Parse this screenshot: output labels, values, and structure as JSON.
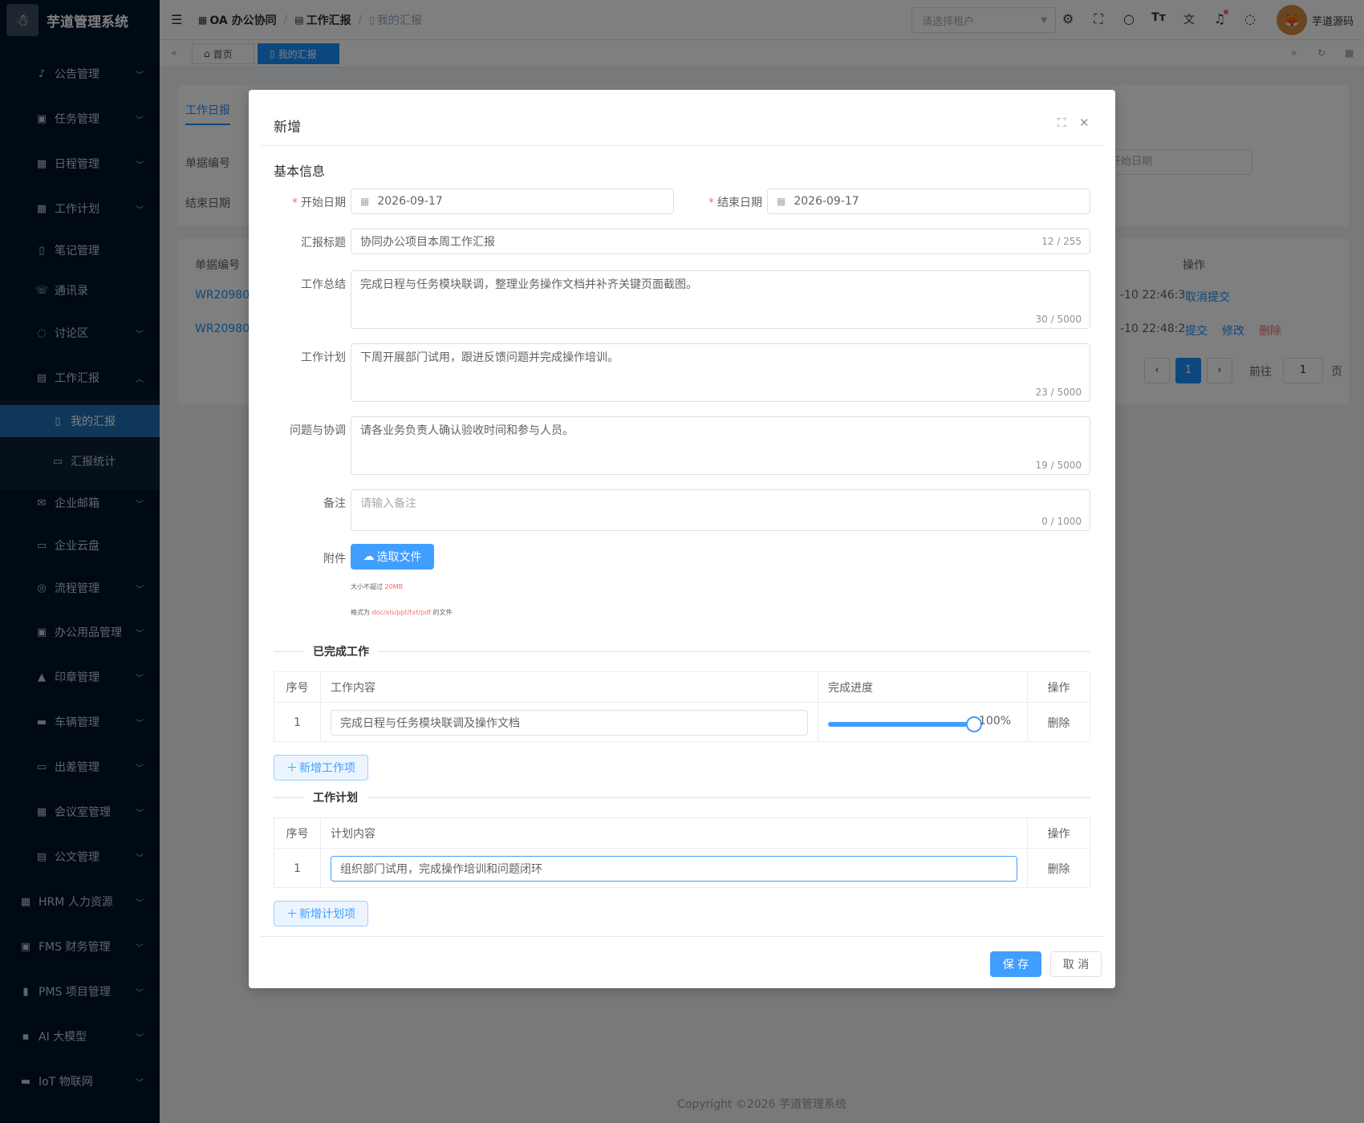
{
  "app": {
    "logo_text": "芋道管理系统"
  },
  "sidebar": {
    "items": [
      {
        "label": "公告管理",
        "icon": "bell-icon"
      },
      {
        "label": "任务管理",
        "icon": "clipboard-icon"
      },
      {
        "label": "日程管理",
        "icon": "calendar-icon"
      },
      {
        "label": "工作计划",
        "icon": "calendar-icon"
      },
      {
        "label": "笔记管理",
        "icon": "notebook-icon"
      },
      {
        "label": "通讯录",
        "icon": "phone-icon"
      },
      {
        "label": "讨论区",
        "icon": "chat-icon"
      },
      {
        "label": "工作汇报",
        "icon": "report-icon"
      },
      {
        "label": "我的汇报",
        "icon": "document-icon"
      },
      {
        "label": "汇报统计",
        "icon": "chart-icon"
      },
      {
        "label": "企业邮箱",
        "icon": "mail-icon"
      },
      {
        "label": "企业云盘",
        "icon": "folder-icon"
      },
      {
        "label": "流程管理",
        "icon": "flow-icon"
      },
      {
        "label": "办公用品管理",
        "icon": "box-icon"
      },
      {
        "label": "印章管理",
        "icon": "stamp-icon"
      },
      {
        "label": "车辆管理",
        "icon": "car-icon"
      },
      {
        "label": "出差管理",
        "icon": "briefcase-icon"
      },
      {
        "label": "会议室管理",
        "icon": "building-icon"
      },
      {
        "label": "公文管理",
        "icon": "file-icon"
      },
      {
        "label": "HRM 人力资源",
        "icon": "building-icon"
      },
      {
        "label": "FMS 财务管理",
        "icon": "money-icon"
      },
      {
        "label": "PMS 项目管理",
        "icon": "project-icon"
      },
      {
        "label": "AI 大模型",
        "icon": "ai-icon"
      },
      {
        "label": "IoT 物联网",
        "icon": "iot-icon"
      }
    ]
  },
  "header": {
    "breadcrumb": [
      "OA 办公协同",
      "工作汇报",
      "我的汇报"
    ],
    "tenant_placeholder": "请选择租户",
    "username": "芋道源码"
  },
  "tags": [
    "首页",
    "我的汇报"
  ],
  "background": {
    "tab": "工作日报",
    "label_no": "单据编号",
    "label_end": "结束日期",
    "start_placeholder": "开始日期",
    "col_no": "单据编号",
    "col_action": "操作",
    "rows": [
      {
        "no": "WR20980",
        "time": "-10 22:46:3",
        "actions": [
          "取消提交"
        ]
      },
      {
        "no": "WR20980",
        "time": "-10 22:48:2",
        "actions": [
          "提交",
          "修改",
          "删除"
        ]
      }
    ],
    "pager": {
      "current": "1",
      "goto_label": "前往",
      "goto_value": "1",
      "page_unit": "页"
    }
  },
  "footer": "Copyright ©2026 芋道管理系统",
  "dialog": {
    "title": "新增",
    "section": "基本信息",
    "fields": {
      "start_label": "开始日期",
      "start_value": "2026-09-17",
      "end_label": "结束日期",
      "end_value": "2026-09-17",
      "title_label": "汇报标题",
      "title_value": "协同办公项目本周工作汇报",
      "title_count": "12 / 255",
      "summary_label": "工作总结",
      "summary_value": "完成日程与任务模块联调，整理业务操作文档并补齐关键页面截图。",
      "summary_count": "30 / 5000",
      "plan_label": "工作计划",
      "plan_value": "下周开展部门试用，跟进反馈问题并完成操作培训。",
      "plan_count": "23 / 5000",
      "issue_label": "问题与协调",
      "issue_value": "请各业务负责人确认验收时间和参与人员。",
      "issue_count": "19 / 5000",
      "remark_label": "备注",
      "remark_placeholder": "请输入备注",
      "remark_count": "0 / 1000",
      "attach_label": "附件",
      "upload_label": "选取文件",
      "tip1_prefix": "大小不超过",
      "tip1_value": "20MB",
      "tip2_prefix": "格式为",
      "tip2_value": "doc/xls/ppt/txt/pdf",
      "tip2_suffix": "的文件"
    },
    "done_section": "已完成工作",
    "done_table": {
      "col_index": "序号",
      "col_content": "工作内容",
      "col_progress": "完成进度",
      "col_action": "操作",
      "rows": [
        {
          "index": "1",
          "content": "完成日程与任务模块联调及操作文档",
          "progress": 100,
          "progress_text": "100%",
          "action": "删除"
        }
      ],
      "add_label": "新增工作项"
    },
    "plan_section": "工作计划",
    "plan_table": {
      "col_index": "序号",
      "col_content": "计划内容",
      "col_action": "操作",
      "rows": [
        {
          "index": "1",
          "content": "组织部门试用，完成操作培训和问题闭环",
          "action": "删除"
        }
      ],
      "add_label": "新增计划项"
    },
    "save_label": "保 存",
    "cancel_label": "取 消"
  }
}
